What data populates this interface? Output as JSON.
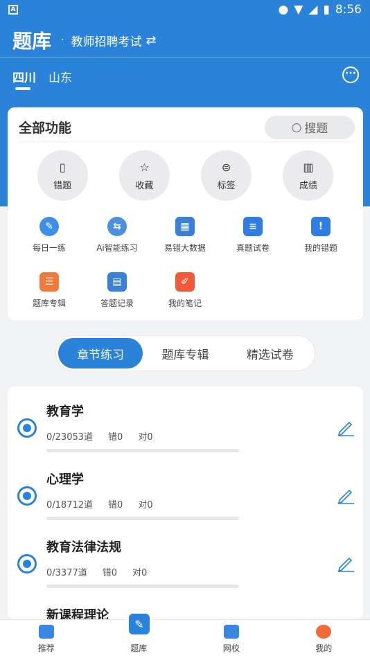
{
  "status_bar": {
    "time": "8:56",
    "left_badge": "A"
  },
  "header": {
    "title": "题库",
    "subject": "教师招聘考试",
    "swap_icon": "swap-icon",
    "regions": [
      {
        "label": "四川",
        "active": true
      },
      {
        "label": "山东",
        "active": false
      }
    ],
    "more_icon": "more-icon"
  },
  "functions": {
    "title": "全部功能",
    "search_label": "搜题",
    "circles": [
      {
        "label": "错题",
        "icon": "notebook-icon"
      },
      {
        "label": "收藏",
        "icon": "star-icon"
      },
      {
        "label": "标签",
        "icon": "tag-icon"
      },
      {
        "label": "成绩",
        "icon": "chart-icon"
      }
    ],
    "grid": [
      {
        "label": "每日一练",
        "icon": "daily-practice-icon",
        "color": "#3c8ee6"
      },
      {
        "label": "Ai智能练习",
        "icon": "ai-practice-icon",
        "color": "#4a8fe0"
      },
      {
        "label": "易错大数据",
        "icon": "error-data-icon",
        "color": "#3a7fd9"
      },
      {
        "label": "真题试卷",
        "icon": "exam-paper-icon",
        "color": "#2f7de0"
      },
      {
        "label": "我的错题",
        "icon": "my-mistakes-icon",
        "color": "#2f7de0"
      },
      {
        "label": "题库专辑",
        "icon": "album-icon",
        "color": "#f07a3a"
      },
      {
        "label": "答题记录",
        "icon": "answer-record-icon",
        "color": "#3a7fd9"
      },
      {
        "label": "我的笔记",
        "icon": "notes-icon",
        "color": "#ef5a3a"
      }
    ]
  },
  "segments": [
    {
      "label": "章节练习",
      "active": true
    },
    {
      "label": "题库专辑",
      "active": false
    },
    {
      "label": "精选试卷",
      "active": false
    }
  ],
  "chapters": [
    {
      "name": "教育学",
      "count": "0/23053道",
      "wrong": "错0",
      "right": "对0",
      "progress": 0
    },
    {
      "name": "心理学",
      "count": "0/18712道",
      "wrong": "错0",
      "right": "对0",
      "progress": 0
    },
    {
      "name": "教育法律法规",
      "count": "0/3377道",
      "wrong": "错0",
      "right": "对0",
      "progress": 0
    },
    {
      "name": "新课程理论",
      "count": "",
      "wrong": "",
      "right": "",
      "progress": 0
    }
  ],
  "bottom_nav": [
    {
      "label": "推荐",
      "icon": "thumbs-up-icon"
    },
    {
      "label": "题库",
      "icon": "question-bank-icon"
    },
    {
      "label": "网校",
      "icon": "video-icon"
    },
    {
      "label": "我的",
      "icon": "profile-icon"
    }
  ],
  "colors": {
    "primary": "#2a83d8",
    "background": "#f2f3f5"
  }
}
